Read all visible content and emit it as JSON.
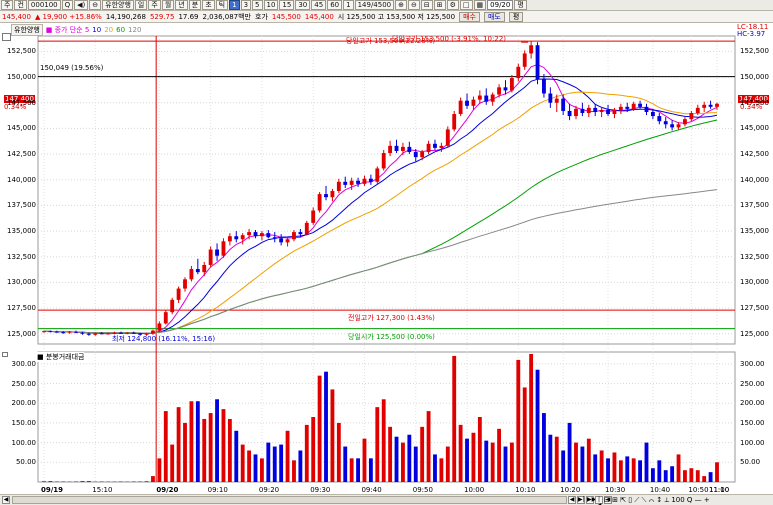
{
  "toolbar": {
    "buttons": [
      "주",
      "컨",
      "000100",
      "Q",
      "◀)",
      "⊖",
      "유한양행",
      "일",
      "주",
      "월",
      "년",
      "분",
      "초",
      "틱",
      "1",
      "3",
      "5",
      "10",
      "15",
      "30",
      "45",
      "60",
      "1",
      "149/4500",
      "⊕",
      "⊖",
      "⊟",
      "⊞",
      "⚙",
      "□",
      "▦"
    ],
    "active_index": 14,
    "date_value": "09/20",
    "share_label": "평"
  },
  "quote": {
    "price": "145,400",
    "change": "▲ 19,900 +15.86%",
    "volume": "14,190,268",
    "trade_value": "529.75",
    "vol_ratio": "17.69",
    "trade_money": "2,036,087백만",
    "hoga_label": "호가",
    "ask": "145,500",
    "bid": "145,400",
    "high": "시 125,500 고 153,500 저 125,500",
    "sell_button": "매수",
    "buy_button": "매도",
    "extra_button": "평"
  },
  "legend": {
    "title": "유한양행",
    "items": [
      "종가 단순 5",
      "10",
      "20",
      "60",
      "120"
    ],
    "colors": [
      "#e000e0",
      "#0000e0",
      "#f0a000",
      "#00a000",
      "#888888"
    ]
  },
  "volume_legend": "■ 분봉거래대금",
  "annotations": {
    "high_line_label": "당일고가 153,500(22.28%)",
    "high_price_label": "당일고가 153,500 (-3.91%, 10:22)",
    "prev_close_line": "150,049 (19.56%)",
    "prev_high_label": "전일고가 127,300 (1.43%)",
    "open_label": "당일시가 125,500 (0.00%)",
    "low_label": "최저 124,800 (16.11%, 15:16)",
    "lc": "LC-18.11",
    "hc": "HC-3.97",
    "current_price": "147,400",
    "current_pct": "0.34%"
  },
  "y_axis_price": [
    "152,500",
    "150,000",
    "147,500",
    "145,000",
    "142,500",
    "140,000",
    "137,500",
    "135,000",
    "132,500",
    "130,000",
    "127,500",
    "125,000"
  ],
  "y_axis_volume": [
    "300.00",
    "250.00",
    "200.00",
    "150.00",
    "100.00",
    "50.00"
  ],
  "x_axis": [
    {
      "label": "09/19",
      "bold": true
    },
    {
      "label": "15:10",
      "bold": false
    },
    {
      "label": "09/20",
      "bold": true
    },
    {
      "label": "09:10",
      "bold": false
    },
    {
      "label": "09:20",
      "bold": false
    },
    {
      "label": "09:30",
      "bold": false
    },
    {
      "label": "09:40",
      "bold": false
    },
    {
      "label": "09:50",
      "bold": false
    },
    {
      "label": "10:00",
      "bold": false
    },
    {
      "label": "10:10",
      "bold": false
    },
    {
      "label": "10:20",
      "bold": false
    },
    {
      "label": "10:30",
      "bold": false
    },
    {
      "label": "10:40",
      "bold": false
    },
    {
      "label": "10:50",
      "bold": false
    },
    {
      "label": "11:00",
      "bold": false
    },
    {
      "label": "11:10",
      "bold": false
    }
  ],
  "footer": {
    "zoom_controls": "⊟ ⊞ ⇱ ▯ ⟋ ⟍ ⌒ ↕ ⟂ 100 Q — +",
    "nav_buttons": [
      "◀",
      "▶|",
      "▶▶",
      "|◀",
      "◀"
    ]
  },
  "chart_data": {
    "type": "candlestick",
    "price_axis": {
      "min": 124000,
      "max": 154000
    },
    "volume_axis": {
      "min": 0,
      "max": 330
    },
    "reference_lines": {
      "day_high": 153500,
      "prev_close_ref": 150049,
      "prev_high": 127300,
      "day_open": 125500
    },
    "candles": [
      [
        125200,
        125300,
        125100,
        125250
      ],
      [
        125250,
        125300,
        125150,
        125200
      ],
      [
        125200,
        125300,
        125100,
        125150
      ],
      [
        125150,
        125250,
        125000,
        125100
      ],
      [
        125100,
        125250,
        125000,
        125200
      ],
      [
        125200,
        125300,
        125050,
        125100
      ],
      [
        125100,
        125200,
        124900,
        125000
      ],
      [
        125000,
        125100,
        124800,
        124900
      ],
      [
        124900,
        125100,
        124800,
        125050
      ],
      [
        125050,
        125150,
        124950,
        125000
      ],
      [
        125000,
        125100,
        124900,
        125050
      ],
      [
        125050,
        125200,
        124950,
        125100
      ],
      [
        125100,
        125200,
        125000,
        125050
      ],
      [
        125050,
        125150,
        124950,
        125100
      ],
      [
        125100,
        125200,
        125000,
        125050
      ],
      [
        125050,
        125100,
        124800,
        124900
      ],
      [
        124900,
        125100,
        124800,
        125000
      ],
      [
        125000,
        125400,
        124900,
        125300
      ],
      [
        125300,
        126200,
        125200,
        126000
      ],
      [
        126000,
        127300,
        125900,
        127100
      ],
      [
        127100,
        128500,
        126900,
        128300
      ],
      [
        128300,
        129600,
        128000,
        129400
      ],
      [
        129400,
        130500,
        129100,
        130300
      ],
      [
        130300,
        131600,
        130100,
        131300
      ],
      [
        131300,
        132300,
        130800,
        131000
      ],
      [
        131000,
        132000,
        130600,
        131700
      ],
      [
        131700,
        133500,
        131500,
        133200
      ],
      [
        133200,
        133800,
        132100,
        132600
      ],
      [
        132600,
        134300,
        132400,
        134000
      ],
      [
        134000,
        134800,
        133600,
        134500
      ],
      [
        134500,
        135000,
        133900,
        134200
      ],
      [
        134200,
        134800,
        133700,
        134600
      ],
      [
        134600,
        135200,
        134200,
        134900
      ],
      [
        134900,
        135100,
        134300,
        134500
      ],
      [
        134500,
        135000,
        134100,
        134800
      ],
      [
        134800,
        135100,
        134300,
        134400
      ],
      [
        134400,
        134900,
        133900,
        134300
      ],
      [
        134300,
        134700,
        133600,
        133900
      ],
      [
        133900,
        134400,
        133500,
        134200
      ],
      [
        134200,
        135100,
        134000,
        134900
      ],
      [
        134900,
        135200,
        134400,
        134700
      ],
      [
        134700,
        136000,
        134600,
        135800
      ],
      [
        135800,
        137300,
        135600,
        137000
      ],
      [
        137000,
        138800,
        136800,
        138600
      ],
      [
        138600,
        139400,
        138000,
        138300
      ],
      [
        138300,
        139100,
        137900,
        138900
      ],
      [
        138900,
        140100,
        138700,
        139800
      ],
      [
        139800,
        140300,
        139200,
        139500
      ],
      [
        139500,
        140200,
        139000,
        139900
      ],
      [
        139900,
        140200,
        139300,
        139600
      ],
      [
        139600,
        140400,
        139400,
        140100
      ],
      [
        140100,
        140500,
        139500,
        139800
      ],
      [
        139800,
        141300,
        139600,
        141100
      ],
      [
        141100,
        142900,
        140900,
        142600
      ],
      [
        142600,
        143800,
        142300,
        143300
      ],
      [
        143300,
        143900,
        142600,
        142800
      ],
      [
        142800,
        143600,
        142400,
        143200
      ],
      [
        143200,
        143700,
        142500,
        142700
      ],
      [
        142700,
        143000,
        141800,
        142200
      ],
      [
        142200,
        142900,
        141900,
        142700
      ],
      [
        142700,
        143800,
        142500,
        143500
      ],
      [
        143500,
        143900,
        142900,
        143100
      ],
      [
        143100,
        143600,
        142700,
        143300
      ],
      [
        143300,
        145200,
        143100,
        144900
      ],
      [
        144900,
        146700,
        144700,
        146400
      ],
      [
        146400,
        148000,
        146200,
        147700
      ],
      [
        147700,
        148400,
        146900,
        147200
      ],
      [
        147200,
        148100,
        146800,
        147800
      ],
      [
        147800,
        148700,
        147400,
        148200
      ],
      [
        148200,
        148900,
        147300,
        147600
      ],
      [
        147600,
        148500,
        147200,
        148300
      ],
      [
        148300,
        149300,
        148000,
        149000
      ],
      [
        149000,
        149700,
        148300,
        148700
      ],
      [
        148700,
        150200,
        148500,
        149900
      ],
      [
        149900,
        151300,
        149600,
        151000
      ],
      [
        151000,
        152600,
        150700,
        152300
      ],
      [
        152300,
        153500,
        151800,
        153100
      ],
      [
        153100,
        153400,
        149300,
        149800
      ],
      [
        149800,
        150300,
        148000,
        148400
      ],
      [
        148400,
        149000,
        147000,
        147500
      ],
      [
        147500,
        148300,
        146600,
        147900
      ],
      [
        147900,
        148300,
        146300,
        146700
      ],
      [
        146700,
        147400,
        145800,
        146200
      ],
      [
        146200,
        147200,
        145900,
        146900
      ],
      [
        146900,
        147500,
        146200,
        146500
      ],
      [
        146500,
        147300,
        146100,
        147000
      ],
      [
        147000,
        147400,
        146200,
        146600
      ],
      [
        146600,
        147100,
        146100,
        146800
      ],
      [
        146800,
        147300,
        146200,
        146400
      ],
      [
        146400,
        147000,
        146000,
        146800
      ],
      [
        146800,
        147400,
        146400,
        147100
      ],
      [
        147100,
        147500,
        146600,
        146900
      ],
      [
        146900,
        147600,
        146700,
        147400
      ],
      [
        147400,
        147700,
        146900,
        147100
      ],
      [
        147100,
        147400,
        146300,
        146600
      ],
      [
        146600,
        146900,
        145900,
        146200
      ],
      [
        146200,
        146500,
        145400,
        145700
      ],
      [
        145700,
        146100,
        145000,
        145400
      ],
      [
        145400,
        145800,
        144800,
        145100
      ],
      [
        145100,
        145600,
        144900,
        145400
      ],
      [
        145400,
        146100,
        145200,
        145900
      ],
      [
        145900,
        146700,
        145700,
        146500
      ],
      [
        146500,
        147300,
        146300,
        147000
      ],
      [
        147000,
        147600,
        146600,
        147300
      ],
      [
        147300,
        147700,
        146900,
        147100
      ],
      [
        147100,
        147500,
        146800,
        147400
      ]
    ],
    "volumes": [
      2,
      2,
      1,
      1,
      1,
      1,
      2,
      2,
      1,
      1,
      1,
      1,
      1,
      1,
      1,
      1,
      2,
      15,
      60,
      180,
      95,
      190,
      150,
      205,
      205,
      160,
      175,
      210,
      185,
      160,
      130,
      95,
      80,
      70,
      60,
      100,
      90,
      95,
      130,
      55,
      80,
      145,
      165,
      270,
      280,
      235,
      150,
      90,
      60,
      60,
      110,
      60,
      190,
      210,
      140,
      115,
      100,
      120,
      90,
      140,
      180,
      70,
      60,
      90,
      320,
      145,
      110,
      125,
      165,
      105,
      100,
      135,
      90,
      100,
      310,
      240,
      325,
      285,
      175,
      120,
      115,
      80,
      150,
      100,
      90,
      110,
      70,
      80,
      60,
      75,
      55,
      65,
      60,
      55,
      100,
      35,
      55,
      30,
      40,
      70,
      30,
      35,
      30,
      15,
      25,
      50
    ]
  }
}
